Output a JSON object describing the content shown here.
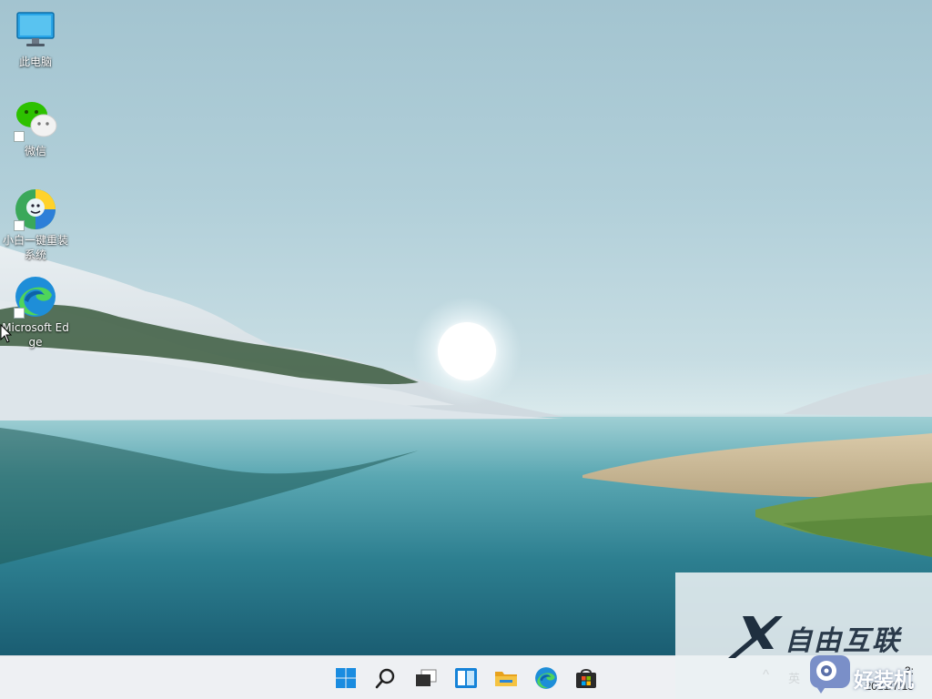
{
  "desktop": {
    "icons": [
      {
        "label": "此电脑",
        "icon": "this-pc-monitor-icon"
      },
      {
        "label": "微信",
        "icon": "wechat-icon"
      },
      {
        "label": "小白一键重装系统",
        "icon": "xiaobai-reinstall-icon"
      },
      {
        "label": "Microsoft Edge",
        "icon": "edge-icon"
      }
    ]
  },
  "taskbar": {
    "buttons": [
      {
        "name": "start",
        "icon": "windows-start-icon"
      },
      {
        "name": "search",
        "icon": "search-icon"
      },
      {
        "name": "task-view",
        "icon": "task-view-icon"
      },
      {
        "name": "widgets",
        "icon": "widgets-icon"
      },
      {
        "name": "file-explorer",
        "icon": "folder-icon"
      },
      {
        "name": "edge",
        "icon": "edge-icon"
      },
      {
        "name": "store",
        "icon": "store-bag-icon"
      }
    ],
    "tray": {
      "overflow_chevron": "^",
      "input_language": "英",
      "time": "3:",
      "date": "2021/7/15"
    }
  },
  "watermark": {
    "text": "自由互联",
    "badge_text": "好装机"
  },
  "colors": {
    "taskbar_bg": "#eef0f3",
    "windows_blue": "#1a8ce0",
    "folder_yellow": "#f5c341"
  }
}
